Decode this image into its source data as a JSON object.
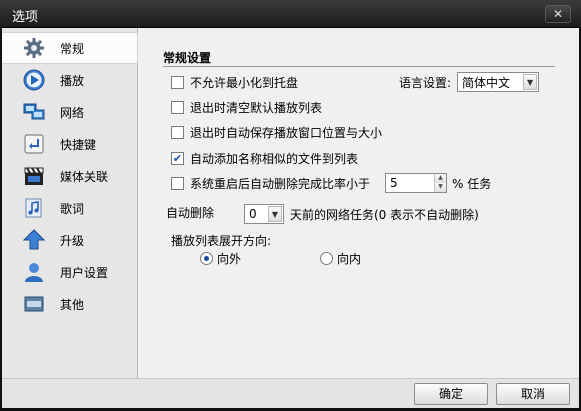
{
  "window": {
    "title": "选项",
    "close_glyph": "✕"
  },
  "sidebar": {
    "items": [
      {
        "label": "常规",
        "icon": "gear-icon",
        "active": true
      },
      {
        "label": "播放",
        "icon": "play-icon"
      },
      {
        "label": "网络",
        "icon": "network-icon"
      },
      {
        "label": "快捷键",
        "icon": "shortcut-key-icon"
      },
      {
        "label": "媒体关联",
        "icon": "clapperboard-icon"
      },
      {
        "label": "歌词",
        "icon": "lyrics-note-icon"
      },
      {
        "label": "升级",
        "icon": "upgrade-arrow-icon"
      },
      {
        "label": "用户设置",
        "icon": "user-icon"
      },
      {
        "label": "其他",
        "icon": "other-box-icon"
      }
    ]
  },
  "general": {
    "section_title": "常规设置",
    "minimize_to_tray": {
      "label": "不允许最小化到托盘",
      "checked": false
    },
    "language": {
      "label": "语言设置:",
      "value": "简体中文"
    },
    "clear_playlist": {
      "label": "退出时清空默认播放列表",
      "checked": false
    },
    "save_window": {
      "label": "退出时自动保存播放窗口位置与大小",
      "checked": false
    },
    "auto_add_similar": {
      "label": "自动添加名称相似的文件到列表",
      "checked": true
    },
    "restart_delete": {
      "label": "系统重启后自动删除完成比率小于",
      "checked": false,
      "value": "5",
      "suffix": "% 任务"
    },
    "auto_delete": {
      "label": "自动删除",
      "value": "0",
      "suffix": "天前的网络任务(0 表示不自动删除)"
    },
    "playlist_direction": {
      "label": "播放列表展开方向:",
      "outward": "向外",
      "inward": "向内",
      "selected": "outward"
    }
  },
  "footer": {
    "ok_label": "确定",
    "cancel_label": "取消"
  },
  "colors": {
    "accent": "#1a4fa0",
    "titlebar": "#2a2a2a"
  }
}
